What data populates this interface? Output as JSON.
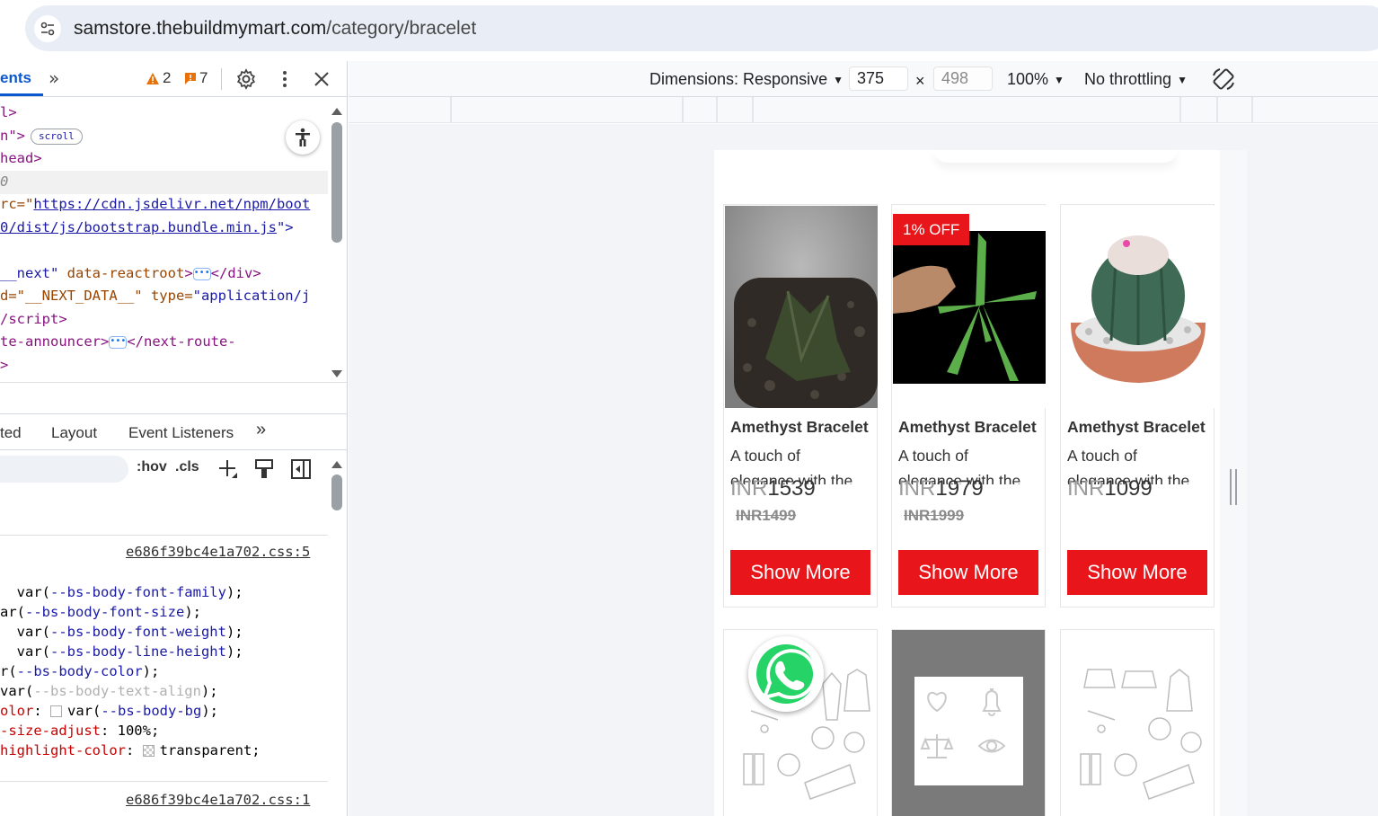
{
  "browser": {
    "url_host": "samstore.thebuildmymart.com",
    "url_path": "/category/bracelet"
  },
  "devtools": {
    "active_tab": "ents",
    "warnings_count": "2",
    "errors_count": "7",
    "elements_lines": [
      {
        "text_a": "l>"
      },
      {
        "text_a": "n\">",
        "pill": "scroll"
      },
      {
        "text_a": "head>"
      },
      {
        "text_a": "0"
      },
      {
        "text_a": "rc=\"",
        "link": "https://cdn.jsdelivr.net/npm/boot"
      },
      {
        "link": "0/dist/js/bootstrap.bundle.min.js",
        "text_b": "\">"
      },
      {
        "text_a": "__next\"",
        "attr": " data-reactroot",
        "text_b": ">",
        "text_c": "</div>"
      },
      {
        "text_a": "d=\"__NEXT_DATA__\"",
        "attr": " type=",
        "val": "\"application/j"
      },
      {
        "text_a": "/script>"
      },
      {
        "text_a": "te-announcer>",
        "text_c": "</next-route-"
      },
      {
        "text_a": ">"
      }
    ],
    "styles_tabs": [
      "ted",
      "Layout",
      "Event Listeners"
    ],
    "filter_buttons": [
      ":hov",
      ".cls"
    ],
    "css_source_1": "e686f39bc4e1a702.css:5",
    "css_source_2": "e686f39bc4e1a702.css:1",
    "css_rules": [
      {
        "prop": "",
        "pre": "  var(",
        "var": "--bs-body-font-family",
        "post": ");"
      },
      {
        "prop": "",
        "pre": "ar(",
        "var": "--bs-body-font-size",
        "post": ");"
      },
      {
        "prop": "",
        "pre": "  var(",
        "var": "--bs-body-font-weight",
        "post": ");"
      },
      {
        "prop": "",
        "pre": "  var(",
        "var": "--bs-body-line-height",
        "post": ");"
      },
      {
        "prop": "",
        "pre": "r(",
        "var": "--bs-body-color",
        "post": ");"
      },
      {
        "prop": "",
        "pre": "var(",
        "var": "--bs-body-text-align",
        "post": ");",
        "dim": true
      },
      {
        "prop": "olor",
        "pre": ": ",
        "swatch": "white",
        "pre2": "var(",
        "var": "--bs-body-bg",
        "post": ");"
      },
      {
        "prop": "-size-adjust",
        "pre": ": 100%;"
      },
      {
        "prop": "highlight-color",
        "pre": ": ",
        "swatch": "checker",
        "pre2": "transparent;"
      }
    ]
  },
  "device_toolbar": {
    "dimensions_label": "Dimensions: Responsive",
    "width": "375",
    "height_placeholder": "498",
    "times": "×",
    "zoom": "100%",
    "throttling": "No throttling"
  },
  "products": [
    {
      "title": "Amethyst Bracelet",
      "desc_line1": "A touch of",
      "desc_line2": "elegance with the...",
      "currency": "INR",
      "price": "1539",
      "old_price": "INR1499",
      "badge": "",
      "button": "Show More"
    },
    {
      "title": "Amethyst Bracelet",
      "desc_line1": "A touch of",
      "desc_line2": "elegance with the...",
      "currency": "INR",
      "price": "1979",
      "old_price": "INR1999",
      "badge": "1% OFF",
      "button": "Show More"
    },
    {
      "title": "Amethyst Bracelet",
      "desc_line1": "A touch of",
      "desc_line2": "elegance with the...",
      "currency": "INR",
      "price": "1099",
      "old_price": "",
      "badge": "",
      "button": "Show More"
    }
  ],
  "colors": {
    "accent_red": "#e8161b",
    "devtools_blue": "#0b57d0"
  }
}
